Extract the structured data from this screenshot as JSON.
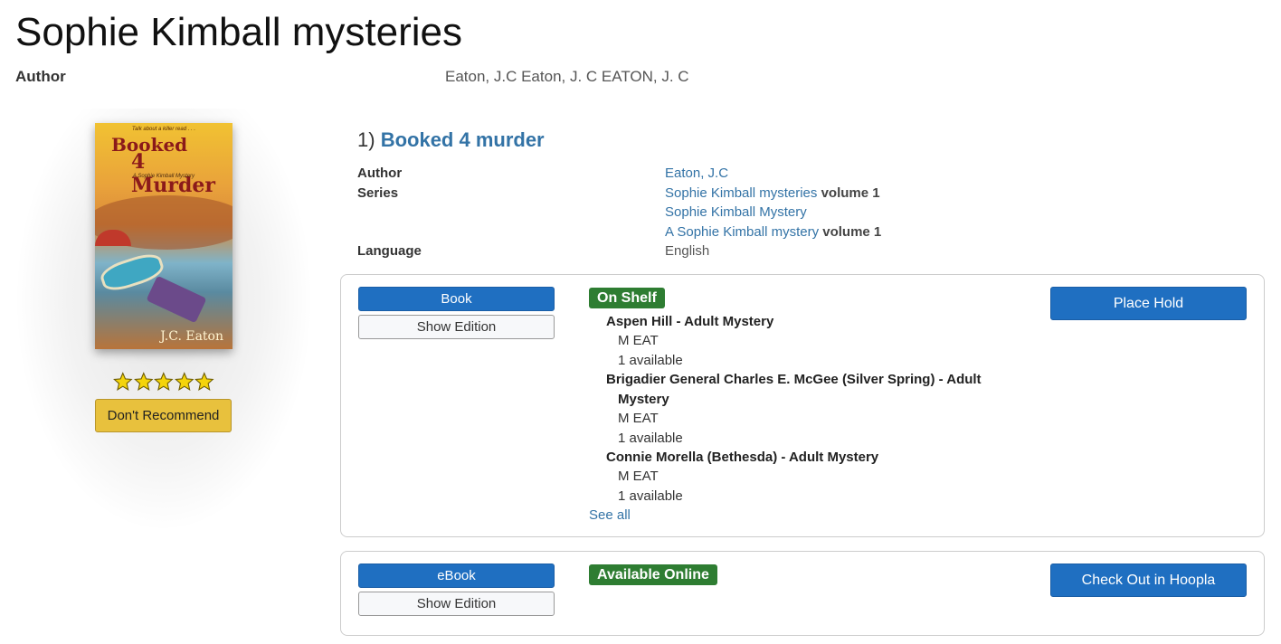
{
  "page": {
    "title": "Sophie Kimball mysteries",
    "author_label": "Author",
    "authors": "Eaton, J.C Eaton, J. C EATON, J. C"
  },
  "cover": {
    "tagline": "Talk about a killer read . . .",
    "title_line1": "Booked",
    "title_line2": "4 Murder",
    "subtitle": "A Sophie Kimball Mystery",
    "author": "J.C. Eaton"
  },
  "rating": {
    "stars": 5,
    "max": 5,
    "star_color": "#f4d40b"
  },
  "dont_recommend_label": "Don't Recommend",
  "result": {
    "number": "1)",
    "title": "Booked 4 murder",
    "labels": {
      "author": "Author",
      "series": "Series",
      "language": "Language"
    },
    "author": "Eaton, J.C",
    "series": [
      {
        "name": "Sophie Kimball mysteries",
        "volume": "volume 1"
      },
      {
        "name": "Sophie Kimball Mystery",
        "volume": ""
      },
      {
        "name": "A Sophie Kimball mystery",
        "volume": "volume 1"
      }
    ],
    "language": "English"
  },
  "formats": [
    {
      "format_label": "Book",
      "edition_label": "Show Edition",
      "status": "On Shelf",
      "action_label": "Place Hold",
      "locations": [
        {
          "name": "Aspen Hill - Adult Mystery",
          "name_cont": "",
          "call_number": "M EAT",
          "availability": "1 available"
        },
        {
          "name": "Brigadier General Charles E. McGee (Silver Spring) - Adult",
          "name_cont": "Mystery",
          "call_number": "M EAT",
          "availability": "1 available"
        },
        {
          "name": "Connie Morella (Bethesda) - Adult Mystery",
          "name_cont": "",
          "call_number": "M EAT",
          "availability": "1 available"
        }
      ],
      "see_all": "See all"
    },
    {
      "format_label": "eBook",
      "edition_label": "Show Edition",
      "status": "Available Online",
      "action_label": "Check Out in Hoopla"
    }
  ],
  "colors": {
    "link": "#3373a6",
    "primary_button": "#1f6fc1",
    "status_green": "#2e7d32",
    "dont_recommend": "#e8c13d"
  }
}
